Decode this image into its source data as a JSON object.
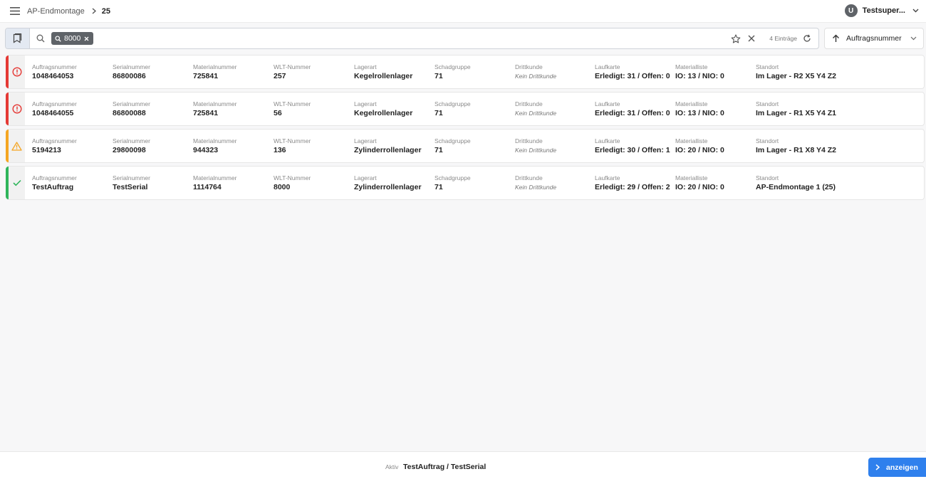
{
  "header": {
    "breadcrumb": "AP-Endmontage",
    "current": "25",
    "user_initial": "U",
    "user_name": "Testsuper..."
  },
  "search": {
    "chip": "8000",
    "placeholder": "",
    "entries": "4 Einträge"
  },
  "sort": {
    "label": "Auftragsnummer"
  },
  "labels": {
    "auftrag": "Auftragsnummer",
    "serial": "Serialnummer",
    "material": "Materialnummer",
    "wlt": "WLT-Nummer",
    "lagerart": "Lagerart",
    "schadgruppe": "Schadgruppe",
    "drittkunde": "Drittkunde",
    "laufkarte": "Laufkarte",
    "materialliste": "Materialliste",
    "standort": "Standort"
  },
  "colors": {
    "error": "#e53935",
    "warning": "#f5a623",
    "success": "#2fb55b",
    "accent": "#2f80ed"
  },
  "rows": [
    {
      "status": "error",
      "icon": "error-circle-icon",
      "auftrag": "1048464053",
      "serial": "86800086",
      "material": "725841",
      "wlt": "257",
      "lagerart": "Kegelrollenlager",
      "schadgruppe": "71",
      "drittkunde": "Kein Drittkunde",
      "laufkarte": "Erledigt: 31 / Offen: 0",
      "materialliste": "IO: 13 / NIO: 0",
      "standort": "Im Lager - R2 X5 Y4 Z2"
    },
    {
      "status": "error",
      "icon": "error-circle-icon",
      "auftrag": "1048464055",
      "serial": "86800088",
      "material": "725841",
      "wlt": "56",
      "lagerart": "Kegelrollenlager",
      "schadgruppe": "71",
      "drittkunde": "Kein Drittkunde",
      "laufkarte": "Erledigt: 31 / Offen: 0",
      "materialliste": "IO: 13 / NIO: 0",
      "standort": "Im Lager - R1 X5 Y4 Z1"
    },
    {
      "status": "warning",
      "icon": "warning-triangle-icon",
      "auftrag": "5194213",
      "serial": "29800098",
      "material": "944323",
      "wlt": "136",
      "lagerart": "Zylinderrollenlager",
      "schadgruppe": "71",
      "drittkunde": "Kein Drittkunde",
      "laufkarte": "Erledigt: 30 / Offen: 1",
      "materialliste": "IO: 20 / NIO: 0",
      "standort": "Im Lager - R1 X8 Y4 Z2"
    },
    {
      "status": "success",
      "icon": "check-icon",
      "auftrag": "TestAuftrag",
      "serial": "TestSerial",
      "material": "1114764",
      "wlt": "8000",
      "lagerart": "Zylinderrollenlager",
      "schadgruppe": "71",
      "drittkunde": "Kein Drittkunde",
      "laufkarte": "Erledigt: 29 / Offen: 2",
      "materialliste": "IO: 20 / NIO: 0",
      "standort": "AP-Endmontage 1 (25)"
    }
  ],
  "footer": {
    "active_label": "Aktiv",
    "active_value": "TestAuftrag / TestSerial",
    "show_button": "anzeigen"
  }
}
